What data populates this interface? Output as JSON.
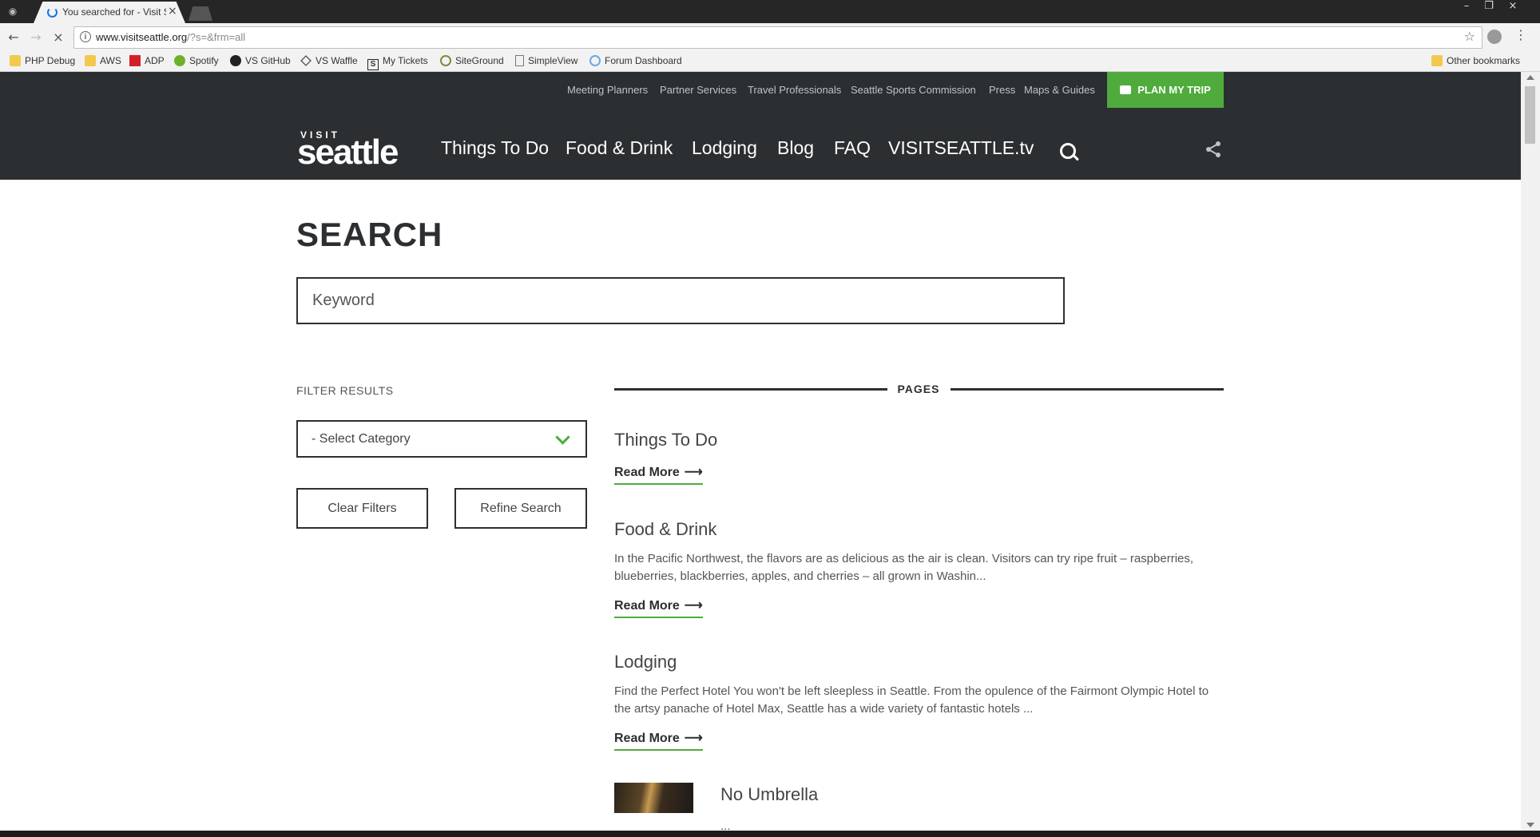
{
  "browser": {
    "tab_title": "You searched for - Visit S",
    "url_host": "www.visitseattle.org",
    "url_path": "/?s=&frm=all",
    "bookmarks": [
      {
        "label": "PHP Debug",
        "icon": "folder-icon"
      },
      {
        "label": "AWS",
        "icon": "folder-icon"
      },
      {
        "label": "ADP",
        "icon": "adp-icon"
      },
      {
        "label": "Spotify",
        "icon": "spotify-icon"
      },
      {
        "label": "VS GitHub",
        "icon": "github-icon"
      },
      {
        "label": "VS Waffle",
        "icon": "waffle-icon"
      },
      {
        "label": "My Tickets",
        "icon": "tickets-icon"
      },
      {
        "label": "SiteGround",
        "icon": "siteground-icon"
      },
      {
        "label": "SimpleView",
        "icon": "page-icon"
      },
      {
        "label": "Forum Dashboard",
        "icon": "forum-icon"
      }
    ],
    "other_bookmarks": "Other bookmarks"
  },
  "site": {
    "utility_links": [
      "Meeting Planners",
      "Partner Services",
      "Travel Professionals",
      "Seattle Sports Commission",
      "Press",
      "Maps & Guides"
    ],
    "plan_button": "PLAN MY TRIP",
    "logo_small": "VISIT",
    "logo_big": "seattle",
    "nav": [
      "Things To Do",
      "Food & Drink",
      "Lodging",
      "Blog",
      "FAQ",
      "VISITSEATTLE.tv"
    ],
    "accent_color": "#4fab3c",
    "header_color": "#2c2f31"
  },
  "search": {
    "title": "SEARCH",
    "keyword_placeholder": "Keyword",
    "keyword_value": ""
  },
  "filters": {
    "label": "FILTER RESULTS",
    "category_selected": "- Select Category",
    "clear_label": "Clear Filters",
    "refine_label": "Refine Search"
  },
  "results": {
    "section_heading": "PAGES",
    "read_more": "Read More",
    "items": [
      {
        "title": "Things To Do",
        "desc": ""
      },
      {
        "title": "Food & Drink",
        "desc": "In the Pacific Northwest, the flavors are as delicious as the air is clean. Visitors can try ripe fruit – raspberries, blueberries, blackberries, apples, and cherries – all grown in Washin..."
      },
      {
        "title": "Lodging",
        "desc": "Find the Perfect Hotel You won't be left sleepless in Seattle. From the opulence of the Fairmont Olympic Hotel to the artsy panache of Hotel Max, Seattle has a wide variety of fantastic hotels ..."
      },
      {
        "title": "No Umbrella",
        "desc": "..."
      }
    ]
  }
}
